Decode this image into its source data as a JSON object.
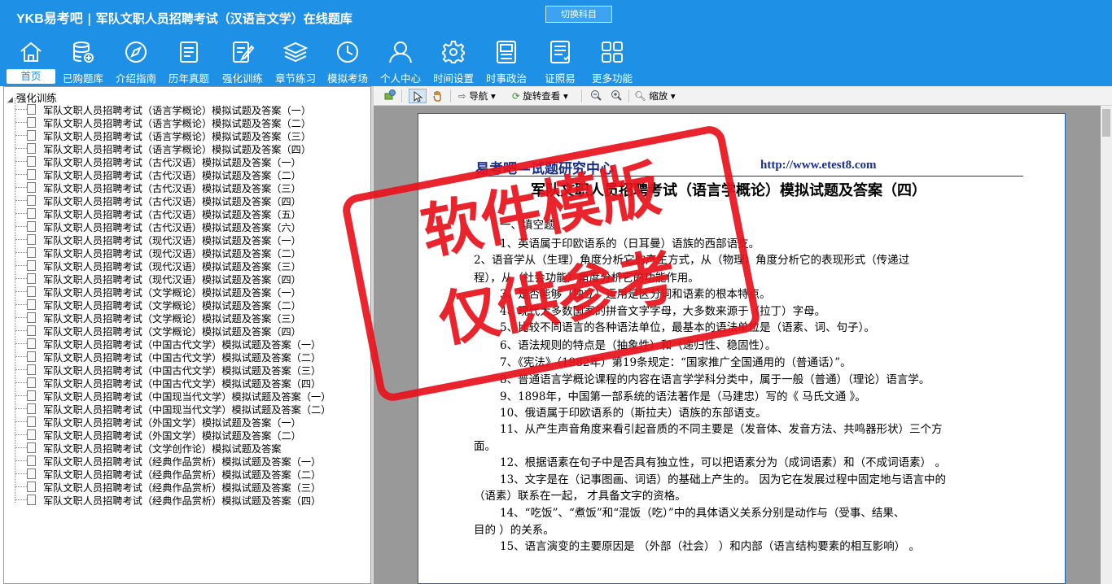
{
  "app": {
    "brand": "YKB易考吧",
    "title": "军队文职人员招聘考试（汉语言文学）在线题库",
    "switch_label": "切换科目"
  },
  "nav": [
    {
      "label": "首页",
      "icon": "home-icon"
    },
    {
      "label": "已购题库",
      "icon": "database-icon"
    },
    {
      "label": "介绍指南",
      "icon": "compass-icon"
    },
    {
      "label": "历年真题",
      "icon": "list-doc-icon"
    },
    {
      "label": "强化训练",
      "icon": "edit-doc-icon"
    },
    {
      "label": "章节练习",
      "icon": "layers-icon"
    },
    {
      "label": "模拟考场",
      "icon": "clock-icon"
    },
    {
      "label": "个人中心",
      "icon": "user-icon"
    },
    {
      "label": "时间设置",
      "icon": "gear-icon"
    },
    {
      "label": "时事政治",
      "icon": "news-icon"
    },
    {
      "label": "证照易",
      "icon": "certificate-icon"
    },
    {
      "label": "更多功能",
      "icon": "grid-icon"
    }
  ],
  "tree": {
    "root": "强化训练",
    "items": [
      "军队文职人员招聘考试（语言学概论）模拟试题及答案（一）",
      "军队文职人员招聘考试（语言学概论）模拟试题及答案（二）",
      "军队文职人员招聘考试（语言学概论）模拟试题及答案（三）",
      "军队文职人员招聘考试（语言学概论）模拟试题及答案（四）",
      "军队文职人员招聘考试（古代汉语）模拟试题及答案（一）",
      "军队文职人员招聘考试（古代汉语）模拟试题及答案（二）",
      "军队文职人员招聘考试（古代汉语）模拟试题及答案（三）",
      "军队文职人员招聘考试（古代汉语）模拟试题及答案（四）",
      "军队文职人员招聘考试（古代汉语）模拟试题及答案（五）",
      "军队文职人员招聘考试（古代汉语）模拟试题及答案（六）",
      "军队文职人员招聘考试（现代汉语）模拟试题及答案（一）",
      "军队文职人员招聘考试（现代汉语）模拟试题及答案（二）",
      "军队文职人员招聘考试（现代汉语）模拟试题及答案（三）",
      "军队文职人员招聘考试（现代汉语）模拟试题及答案（四）",
      "军队文职人员招聘考试（文学概论）模拟试题及答案（一）",
      "军队文职人员招聘考试（文学概论）模拟试题及答案（二）",
      "军队文职人员招聘考试（文学概论）模拟试题及答案（三）",
      "军队文职人员招聘考试（文学概论）模拟试题及答案（四）",
      "军队文职人员招聘考试（中国古代文学）模拟试题及答案（一）",
      "军队文职人员招聘考试（中国古代文学）模拟试题及答案（二）",
      "军队文职人员招聘考试（中国古代文学）模拟试题及答案（三）",
      "军队文职人员招聘考试（中国古代文学）模拟试题及答案（四）",
      "军队文职人员招聘考试（中国现当代文学）模拟试题及答案（一）",
      "军队文职人员招聘考试（中国现当代文学）模拟试题及答案（二）",
      "军队文职人员招聘考试（外国文学）模拟试题及答案（一）",
      "军队文职人员招聘考试（外国文学）模拟试题及答案（二）",
      "军队文职人员招聘考试（文学创作论）模拟试题及答案",
      "军队文职人员招聘考试（经典作品赏析）模拟试题及答案（一）",
      "军队文职人员招聘考试（经典作品赏析）模拟试题及答案（二）",
      "军队文职人员招聘考试（经典作品赏析）模拟试题及答案（三）",
      "军队文职人员招聘考试（经典作品赏析）模拟试题及答案（四）"
    ]
  },
  "toolbar": {
    "navigate": "导航",
    "rotate": "旋转查看",
    "zoom": "缩放"
  },
  "document": {
    "header_left": "易考吧—试题研究中心",
    "header_right": "http://www.etest8.com",
    "title": "军队文职人员招聘考试（语言学概论）模拟试题及答案（四）",
    "lines": [
      "一、填空题",
      "1、英语属于印欧语系的（日耳曼）语族的西部语支。",
      "2、语音学从（生理）角度分析它的产生方式，从（物理）角度分析它的表现形式（传递过",
      "程），从（社会功能）角度分析它的功能作用。",
      "3、是否能够（独立）运用是区分词和语素的根本特点。",
      "4、现代大多数国家的拼音文字字母，大多数来源于（拉丁）字母。",
      "5、比较不同语言的各种语法单位，最基本的语法单位是（语素、词、句子）。",
      "6、语法规则的特点是（抽象性）和（递归性、稳固性）。",
      "7、《宪法》（1982年）第19条规定：“国家推广全国通用的（普通话）”。",
      "8、普通语言学概论课程的内容在语言学学科分类中，属于一般（普通）（理论）语言学。",
      "9、1898年，中国第一部系统的语法著作是（马建忠）写的《 马氏文通 》。",
      "10、俄语属于印欧语系的（斯拉夫）语族的东部语支。",
      "11、从产生声音角度来看引起音质的不同主要是（发音体、发音方法、共鸣器形状）三个方",
      "面。",
      "12、根据语素在句子中是否具有独立性，可以把语素分为（成词语素）和（不成词语素） 。",
      "13、文字是在（记事图画、词语）的基础上产生的。 因为它在发展过程中固定地与语言中的",
      "（语素）联系在一起， 才具备文字的资格。",
      "14、“吃饭”、“煮饭”和“混饭（吃）”中的具体语义关系分别是动作与（受事、结果、",
      "目的 ）的关系。",
      "15、语言演变的主要原因是 （外部（社会） ）和内部（语言结构要素的相互影响） 。"
    ]
  },
  "stamp": {
    "line1": "软件模版",
    "line2": "仅供参考",
    "color": "#e8121c"
  },
  "colors": {
    "topbar": "#1e90e6",
    "header_text": "#1a2e8c"
  }
}
